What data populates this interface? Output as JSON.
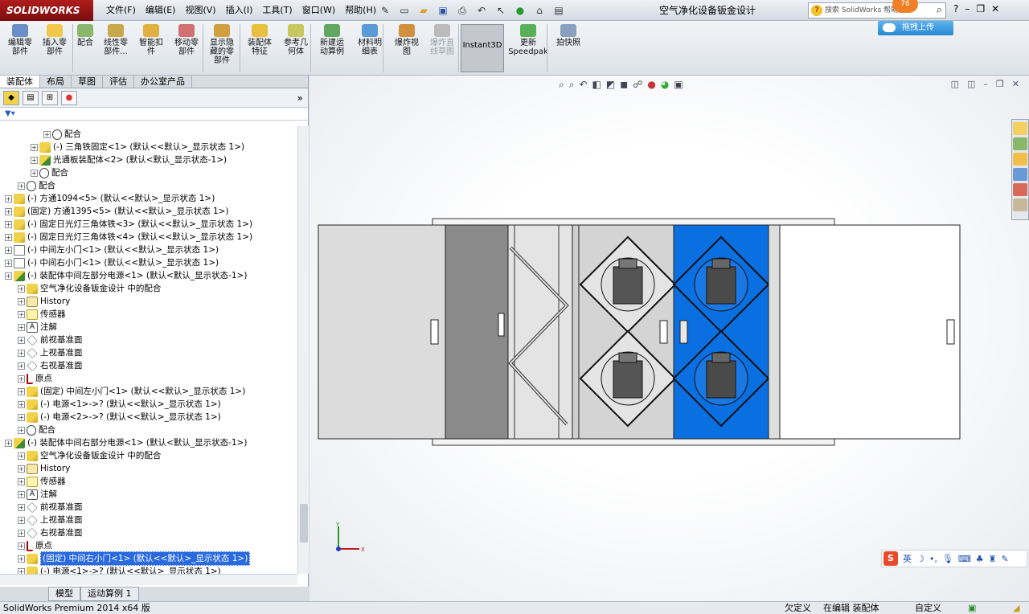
{
  "titlebar": {
    "logo": "SOLIDWORKS",
    "menus": [
      "文件(F)",
      "编辑(E)",
      "视图(V)",
      "插入(I)",
      "工具(T)",
      "窗口(W)",
      "帮助(H)"
    ],
    "doc_title": "空气净化设备钣金设计",
    "search_placeholder": "搜索 SolidWorks 帮助",
    "badge": "76",
    "help": "?",
    "upload": "拖拽上传"
  },
  "commands": [
    {
      "label": "编辑零\n部件"
    },
    {
      "label": "插入零\n部件"
    },
    {
      "label": "配合"
    },
    {
      "label": "线性零\n部件..."
    },
    {
      "label": "智能扣\n件"
    },
    {
      "label": "移动零\n部件"
    },
    {
      "label": "显示隐\n藏的零\n部件"
    },
    {
      "label": "装配体\n特征"
    },
    {
      "label": "参考几\n何体"
    },
    {
      "label": "新建运\n动算例"
    },
    {
      "label": "材料明\n细表"
    },
    {
      "label": "爆炸视\n图"
    },
    {
      "label": "爆炸直\n线草图"
    },
    {
      "label": "Instant3D"
    },
    {
      "label": "更新\nSpeedpak"
    },
    {
      "label": "拍快照"
    }
  ],
  "panel_tabs": [
    "装配体",
    "布局",
    "草图",
    "评估",
    "办公室产品"
  ],
  "tree": [
    {
      "indent": 3,
      "icon": "mate",
      "label": "配合"
    },
    {
      "indent": 2,
      "icon": "part",
      "label": "(-) 三角铁固定<1> (默认<<默认>_显示状态 1>)"
    },
    {
      "indent": 2,
      "icon": "asm",
      "label": "光通板装配体<2> (默认<默认_显示状态-1>)"
    },
    {
      "indent": 2,
      "icon": "mate",
      "label": "配合"
    },
    {
      "indent": 1,
      "icon": "mate",
      "label": "配合"
    },
    {
      "indent": 0,
      "icon": "part",
      "label": "(-) 方通1094<5> (默认<<默认>_显示状态 1>)"
    },
    {
      "indent": 0,
      "icon": "part",
      "label": "(固定) 方通1395<5> (默认<<默认>_显示状态 1>)"
    },
    {
      "indent": 0,
      "icon": "part",
      "label": "(-) 固定日光灯三角体铁<3> (默认<<默认>_显示状态 1>)"
    },
    {
      "indent": 0,
      "icon": "part",
      "label": "(-) 固定日光灯三角体铁<4> (默认<<默认>_显示状态 1>)"
    },
    {
      "indent": 0,
      "icon": "open",
      "label": "(-) 中间左小门<1> (默认<<默认>_显示状态 1>)"
    },
    {
      "indent": 0,
      "icon": "open",
      "label": "(-) 中间右小门<1> (默认<<默认>_显示状态 1>)"
    },
    {
      "indent": 0,
      "icon": "asm",
      "label": "(-) 装配体中间左部分电源<1> (默认<默认_显示状态-1>)"
    },
    {
      "indent": 1,
      "icon": "part",
      "label": "空气净化设备钣金设计 中的配合"
    },
    {
      "indent": 1,
      "icon": "hist",
      "label": "History"
    },
    {
      "indent": 1,
      "icon": "sens",
      "label": "传感器"
    },
    {
      "indent": 1,
      "icon": "note",
      "label": "注解"
    },
    {
      "indent": 1,
      "icon": "plane",
      "label": "前视基准面"
    },
    {
      "indent": 1,
      "icon": "plane",
      "label": "上视基准面"
    },
    {
      "indent": 1,
      "icon": "plane",
      "label": "右视基准面"
    },
    {
      "indent": 1,
      "icon": "origin",
      "label": "原点"
    },
    {
      "indent": 1,
      "icon": "part",
      "label": "(固定) 中间左小门<1> (默认<<默认>_显示状态 1>)"
    },
    {
      "indent": 1,
      "icon": "part",
      "label": "(-) 电源<1>->? (默认<<默认>_显示状态 1>)"
    },
    {
      "indent": 1,
      "icon": "part",
      "label": "(-) 电源<2>->? (默认<<默认>_显示状态 1>)"
    },
    {
      "indent": 1,
      "icon": "mate",
      "label": "配合"
    },
    {
      "indent": 0,
      "icon": "asm",
      "label": "(-) 装配体中间右部分电源<1> (默认<默认_显示状态-1>)"
    },
    {
      "indent": 1,
      "icon": "part",
      "label": "空气净化设备钣金设计 中的配合"
    },
    {
      "indent": 1,
      "icon": "hist",
      "label": "History"
    },
    {
      "indent": 1,
      "icon": "sens",
      "label": "传感器"
    },
    {
      "indent": 1,
      "icon": "note",
      "label": "注解"
    },
    {
      "indent": 1,
      "icon": "plane",
      "label": "前视基准面"
    },
    {
      "indent": 1,
      "icon": "plane",
      "label": "上视基准面"
    },
    {
      "indent": 1,
      "icon": "plane",
      "label": "右视基准面"
    },
    {
      "indent": 1,
      "icon": "origin",
      "label": "原点"
    },
    {
      "indent": 1,
      "icon": "part",
      "label": "(固定) 中间右小门<1> (默认<<默认>_显示状态 1>)",
      "selected": true
    },
    {
      "indent": 1,
      "icon": "part",
      "label": "(-) 电源<1>->? (默认<<默认>_显示状态 1>)"
    }
  ],
  "bottom_tabs": [
    "模型",
    "运动算例 1"
  ],
  "ime": {
    "lang": "英"
  },
  "status": {
    "app": "SolidWorks Premium 2014 x64 版",
    "constraint": "欠定义",
    "mode": "在编辑 装配体",
    "units": "自定义"
  },
  "colors": {
    "selected_panel": "#0a6fe0",
    "brand": "#a31515"
  }
}
